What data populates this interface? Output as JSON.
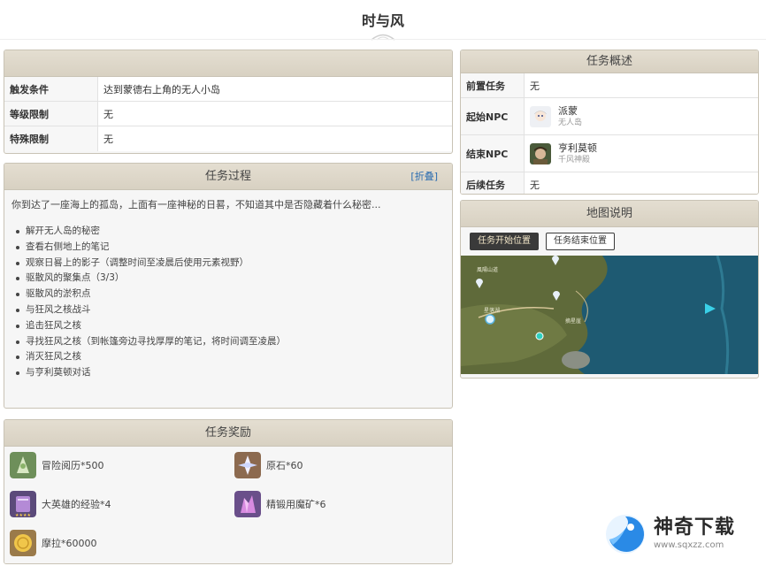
{
  "page_title": "时与风",
  "conditions": {
    "rows": [
      {
        "key": "触发条件",
        "value": "达到蒙德右上角的无人小岛"
      },
      {
        "key": "等级限制",
        "value": "无"
      },
      {
        "key": "特殊限制",
        "value": "无"
      }
    ]
  },
  "process": {
    "title": "任务过程",
    "collapse_link": "[折叠]",
    "intro": "你到达了一座海上的孤岛，上面有一座神秘的日晷，不知道其中是否隐藏着什么秘密...",
    "steps": [
      "解开无人岛的秘密",
      "查看右侧地上的笔记",
      "观察日晷上的影子（调整时间至凌晨后使用元素视野）",
      "驱散风的聚集点（3/3）",
      "驱散风的淤积点",
      "与狂风之核战斗",
      "追击狂风之核",
      "寻找狂风之核（到帐篷旁边寻找厚厚的笔记，将时间调至凌晨）",
      "消灭狂风之核",
      "与亨利莫顿对话"
    ]
  },
  "overview": {
    "title": "任务概述",
    "prev_label": "前置任务",
    "prev_value": "无",
    "start_label": "起始NPC",
    "start_npc_name": "派蒙",
    "start_npc_sub": "无人岛",
    "end_label": "结束NPC",
    "end_npc_name": "亨利莫顿",
    "end_npc_sub": "千风神殿",
    "next_label": "后续任务",
    "next_value": "无"
  },
  "map": {
    "title": "地图说明",
    "tab_start": "任务开始位置",
    "tab_end": "任务结束位置",
    "active_tab": "任务开始位置",
    "labels": {
      "l1": "風陽山道",
      "l2": "星落湖",
      "l3": "摘星崖"
    }
  },
  "rewards": {
    "title": "任务奖励",
    "items": [
      {
        "label": "冒险阅历*500",
        "icon": "adventure-exp-icon"
      },
      {
        "label": "原石*60",
        "icon": "primogem-icon"
      },
      {
        "label": "大英雄的经验*4",
        "icon": "heros-wit-icon"
      },
      {
        "label": "精锻用魔矿*6",
        "icon": "mystic-enhancement-ore-icon"
      },
      {
        "label": "摩拉*60000",
        "icon": "mora-icon"
      }
    ]
  },
  "watermark": {
    "name": "神奇下载",
    "url": "www.sqxzz.com"
  },
  "colors": {
    "panel_header": "#dcd5c7",
    "panel_border": "#c9c3b5",
    "link": "#2b6cb0",
    "tab_active_bg": "#3a3a3a",
    "sea": "#1e5a72",
    "land": "#5f6a3a"
  }
}
